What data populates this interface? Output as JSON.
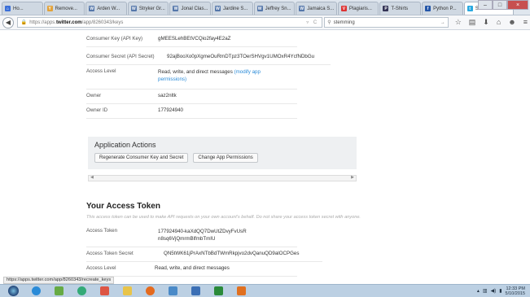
{
  "browser": {
    "tabs": [
      {
        "label": "Ho...",
        "color": "#3a6fd8",
        "glyph": "H"
      },
      {
        "label": "Remove...",
        "color": "#e2a23a",
        "glyph": "Y"
      },
      {
        "label": "Arden W...",
        "color": "#5577aa",
        "glyph": "W"
      },
      {
        "label": "Stryker Gr...",
        "color": "#5577aa",
        "glyph": "W"
      },
      {
        "label": "Jonal Clas...",
        "color": "#5577aa",
        "glyph": "W"
      },
      {
        "label": "Jardine S...",
        "color": "#5577aa",
        "glyph": "W"
      },
      {
        "label": "Jeffrey Sn...",
        "color": "#5577aa",
        "glyph": "W"
      },
      {
        "label": "Jamaica S...",
        "color": "#5577aa",
        "glyph": "W"
      },
      {
        "label": "Plagiaris...",
        "color": "#d33",
        "glyph": "V"
      },
      {
        "label": "T-Shirts",
        "color": "#335",
        "glyph": "P"
      },
      {
        "label": "Python P...",
        "color": "#2456a8",
        "glyph": "f"
      },
      {
        "label": "Sham...",
        "color": "#2aa9e0",
        "glyph": "t"
      }
    ],
    "url_prefix": "https://apps.",
    "url_domain": "twitter.com",
    "url_path": "/app/8260343/keys",
    "url_tools": "▿ C",
    "search_value": "stemming",
    "status_url": "https://apps.twitter.com/app/8260343/recreate_keys"
  },
  "app_keys": {
    "rows": [
      {
        "label": "Consumer Key (API Key)",
        "value": "gMEESLehBEtVCQio2fay4E2aZ"
      },
      {
        "label": "Consumer Secret (API Secret)",
        "value": "92ajBooXo0pXgmeOuRmDTpz3TOerSHVgv1UMOxR4YcfNDbGu"
      },
      {
        "label": "Access Level",
        "value": "Read, write, and direct messages",
        "link": "(modify app permissions)"
      },
      {
        "label": "Owner",
        "value": "saz2nltk"
      },
      {
        "label": "Owner ID",
        "value": "177924940"
      }
    ]
  },
  "application_actions": {
    "title": "Application Actions",
    "regenerate_label": "Regenerate Consumer Key and Secret",
    "change_perms_label": "Change App Permissions"
  },
  "access_token": {
    "title": "Your Access Token",
    "note": "This access token can be used to make API requests on your own account's behalf. Do not share your access token secret with anyone.",
    "rows": [
      {
        "label": "Access Token",
        "value": "177924940-kaXdQQ7DwUtZDvyFvUsRn8sq6VjQmrmBlfmbTmIU"
      },
      {
        "label": "Access Token Secret",
        "value": "QN5tWK61jPrAxNTbBdTWmRkpjvo2dvQanuQD9alOCPGes"
      },
      {
        "label": "Access Level",
        "value": "Read, write, and direct messages"
      }
    ]
  },
  "taskbar": {
    "clock_time": "12:33 PM",
    "clock_date": "5/10/2015"
  }
}
